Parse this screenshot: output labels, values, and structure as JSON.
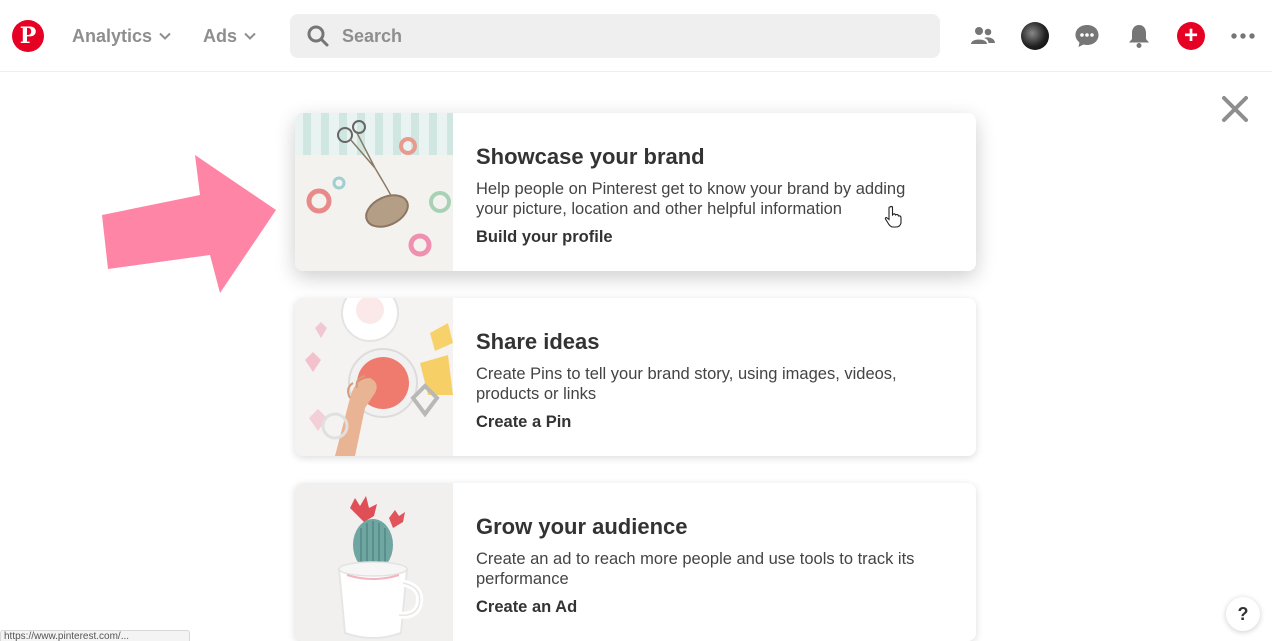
{
  "header": {
    "logo_letter": "P",
    "nav": [
      {
        "label": "Analytics"
      },
      {
        "label": "Ads"
      }
    ],
    "search": {
      "placeholder": "Search",
      "value": ""
    },
    "icons": [
      "people-icon",
      "avatar",
      "chat-icon",
      "bell-icon",
      "plus-icon",
      "more-icon"
    ]
  },
  "cards": [
    {
      "title": "Showcase your brand",
      "description": "Help people on Pinterest get to know your brand by adding your picture, location and other helpful information",
      "link": "Build your profile"
    },
    {
      "title": "Share ideas",
      "description": "Create Pins to tell your brand story, using images, videos, products or links",
      "link": "Create a Pin"
    },
    {
      "title": "Grow your audience",
      "description": "Create an ad to reach more people and use tools to track its performance",
      "link": "Create an Ad"
    }
  ],
  "help": {
    "label": "?"
  },
  "status_url": "https://www.pinterest.com/...",
  "colors": {
    "brand": "#e60023",
    "arrow": "#ff85a6"
  }
}
